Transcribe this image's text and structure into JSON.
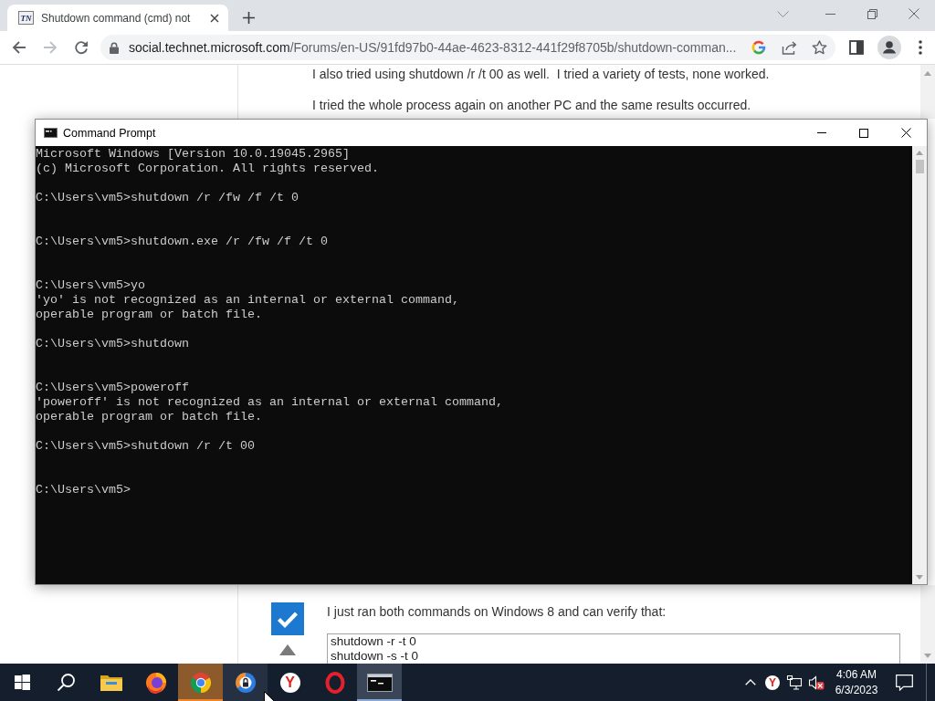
{
  "browser": {
    "tabs": [
      {
        "favicon_text": "TN",
        "title": "Shutdown command (cmd) not",
        "selected": true
      }
    ],
    "nav_buttons": [
      {
        "kind": "back",
        "disabled": false
      },
      {
        "kind": "forward",
        "disabled": true
      },
      {
        "kind": "reload",
        "disabled": false
      }
    ],
    "address_bar": {
      "host": "social.technet.microsoft.com",
      "path": "/Forums/en-US/91fd97b0-44ae-4623-8312-441f29f8705b/shutdown-comman..."
    }
  },
  "page": {
    "paragraphs": [
      "I also tried using shutdown /r /t 00 as well.  I tried a variety of tests, none worked.",
      "I tried the whole process again on another PC and the same results occurred."
    ],
    "answer": {
      "accepted": true,
      "text": "I just ran both commands on Windows 8 and can verify that:",
      "code_lines": [
        "shutdown -r -t 0",
        "shutdown -s -t 0"
      ]
    }
  },
  "console_window": {
    "title": "Command Prompt",
    "header": [
      "Microsoft Windows [Version 10.0.19045.2965]",
      "(c) Microsoft Corporation. All rights reserved."
    ],
    "entries": [
      {
        "input": "C:\\Users\\vm5>shutdown /r /fw /f /t 0"
      },
      {
        "input": "C:\\Users\\vm5>shutdown.exe /r /fw /f /t 0"
      },
      {
        "input": "C:\\Users\\vm5>yo",
        "output": [
          "'yo' is not recognized as an internal or external command,",
          "operable program or batch file."
        ]
      },
      {
        "input": "C:\\Users\\vm5>shutdown"
      },
      {
        "input": "C:\\Users\\vm5>poweroff",
        "output": [
          "'poweroff' is not recognized as an internal or external command,",
          "operable program or batch file."
        ]
      },
      {
        "input": "C:\\Users\\vm5>shutdown /r /t 00"
      }
    ],
    "current_prompt": "C:\\Users\\vm5>"
  },
  "taskbar": {
    "apps": [
      {
        "kind": "start",
        "selected": false,
        "flashing": false,
        "hovered": false
      },
      {
        "kind": "search",
        "selected": false,
        "flashing": false,
        "hovered": false
      },
      {
        "kind": "files",
        "selected": false,
        "flashing": false,
        "hovered": false
      },
      {
        "kind": "firefox",
        "selected": false,
        "flashing": false,
        "hovered": false
      },
      {
        "kind": "chrome",
        "selected": false,
        "flashing": true,
        "hovered": false
      },
      {
        "kind": "secure-browser",
        "selected": false,
        "flashing": false,
        "hovered": true
      },
      {
        "kind": "yandex",
        "selected": false,
        "flashing": false,
        "hovered": false,
        "logo_text": "Y"
      },
      {
        "kind": "opera",
        "selected": false,
        "flashing": false,
        "hovered": false
      },
      {
        "kind": "terminal",
        "selected": true,
        "flashing": false,
        "hovered": false
      }
    ],
    "tray": [
      {
        "kind": "chevron"
      },
      {
        "kind": "yandex",
        "logo_text": "Y"
      },
      {
        "kind": "network"
      },
      {
        "kind": "volume"
      }
    ],
    "volume": {
      "muted": true
    },
    "clock": {
      "time": "4:06 AM",
      "date": "6/3/2023"
    }
  },
  "mouse_pointer": {
    "visible": true
  }
}
